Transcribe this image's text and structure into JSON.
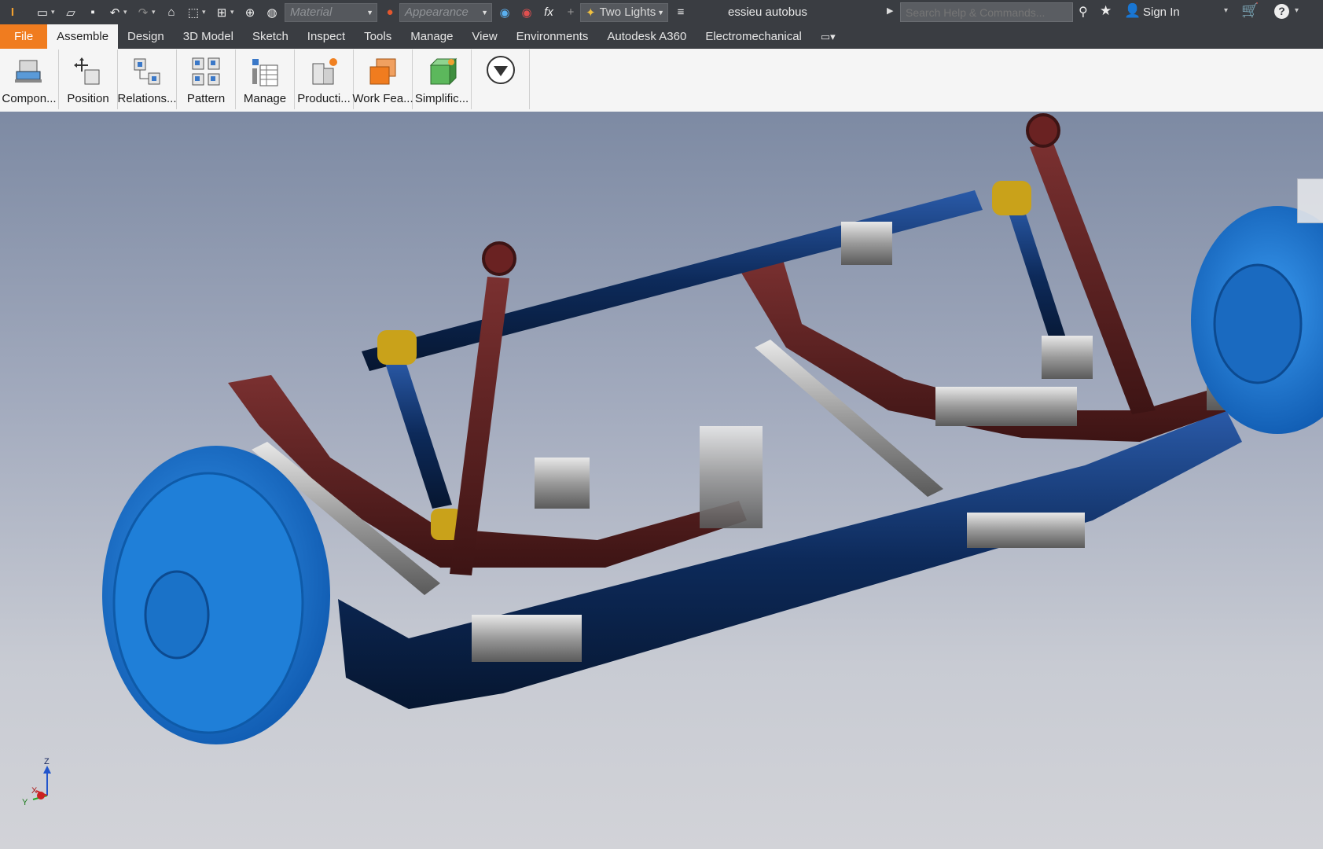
{
  "qat": {
    "material_placeholder": "Material",
    "appearance_placeholder": "Appearance",
    "lighting": "Two Lights",
    "doc_title": "essieu autobus",
    "search_placeholder": "Search Help & Commands...",
    "sign_in": "Sign In",
    "fx": "fx"
  },
  "tabs": [
    "File",
    "Assemble",
    "Design",
    "3D Model",
    "Sketch",
    "Inspect",
    "Tools",
    "Manage",
    "View",
    "Environments",
    "Autodesk A360",
    "Electromechanical"
  ],
  "active_tab": "Assemble",
  "ribbon": {
    "buttons": [
      "Compon...",
      "Position",
      "Relations...",
      "Pattern",
      "Manage",
      "Producti...",
      "Work Fea...",
      "Simplific..."
    ]
  },
  "triad": {
    "z": "Z",
    "y": "Y",
    "x": "X"
  },
  "colors": {
    "file_tab": "#f07c1f",
    "toolbar_bg": "#3a3d42",
    "drum_blue": "#1f7fd8",
    "axle_navy": "#0d2a5a",
    "spring_maroon": "#5a1f1f",
    "bushing_gold": "#c9a21a"
  }
}
